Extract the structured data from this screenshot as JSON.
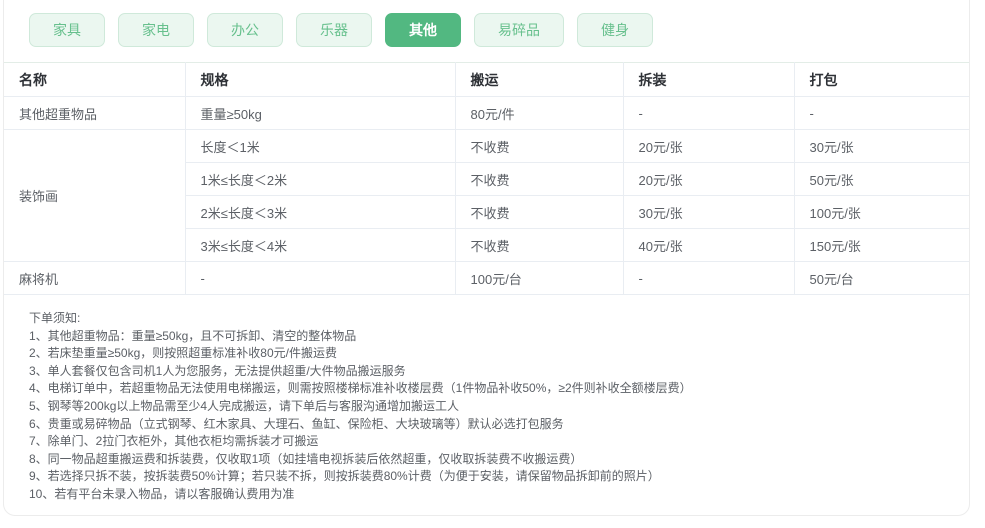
{
  "colors": {
    "accent": "#52b881",
    "tab-bg": "#ebf7f0",
    "tab-border": "#cfe9da",
    "tab-text": "#67c08d",
    "table-border": "#e9edf2",
    "header-text": "#2f3237",
    "cell-text": "#5c6066"
  },
  "tabs": [
    {
      "label": "家具",
      "active": false
    },
    {
      "label": "家电",
      "active": false
    },
    {
      "label": "办公",
      "active": false
    },
    {
      "label": "乐器",
      "active": false
    },
    {
      "label": "其他",
      "active": true
    },
    {
      "label": "易碎品",
      "active": false
    },
    {
      "label": "健身",
      "active": false
    }
  ],
  "table": {
    "headers": [
      "名称",
      "规格",
      "搬运",
      "拆装",
      "打包"
    ],
    "rows": [
      {
        "name": "其他超重物品",
        "cells": [
          [
            "重量≥50kg",
            "80元/件",
            "-",
            "-"
          ]
        ]
      },
      {
        "name": "装饰画",
        "cells": [
          [
            "长度＜1米",
            "不收费",
            "20元/张",
            "30元/张"
          ],
          [
            "1米≤长度＜2米",
            "不收费",
            "20元/张",
            "50元/张"
          ],
          [
            "2米≤长度＜3米",
            "不收费",
            "30元/张",
            "100元/张"
          ],
          [
            "3米≤长度＜4米",
            "不收费",
            "40元/张",
            "150元/张"
          ]
        ]
      },
      {
        "name": "麻将机",
        "cells": [
          [
            "-",
            "100元/台",
            "-",
            "50元/台"
          ]
        ]
      }
    ]
  },
  "notes": {
    "title": "下单须知:",
    "items": [
      "1、其他超重物品：重量≥50kg，且不可拆卸、清空的整体物品",
      "2、若床垫重量≥50kg，则按照超重标准补收80元/件搬运费",
      "3、单人套餐仅包含司机1人为您服务，无法提供超重/大件物品搬运服务",
      "4、电梯订单中，若超重物品无法使用电梯搬运，则需按照楼梯标准补收楼层费（1件物品补收50%，≥2件则补收全额楼层费）",
      "5、钢琴等200kg以上物品需至少4人完成搬运，请下单后与客服沟通增加搬运工人",
      "6、贵重或易碎物品（立式钢琴、红木家具、大理石、鱼缸、保险柜、大块玻璃等）默认必选打包服务",
      "7、除单门、2拉门衣柜外，其他衣柜均需拆装才可搬运",
      "8、同一物品超重搬运费和拆装费，仅收取1项（如挂墙电视拆装后依然超重，仅收取拆装费不收搬运费）",
      "9、若选择只拆不装，按拆装费50%计算；若只装不拆，则按拆装费80%计费（为便于安装，请保留物品拆卸前的照片）",
      "10、若有平台未录入物品，请以客服确认费用为准"
    ]
  }
}
